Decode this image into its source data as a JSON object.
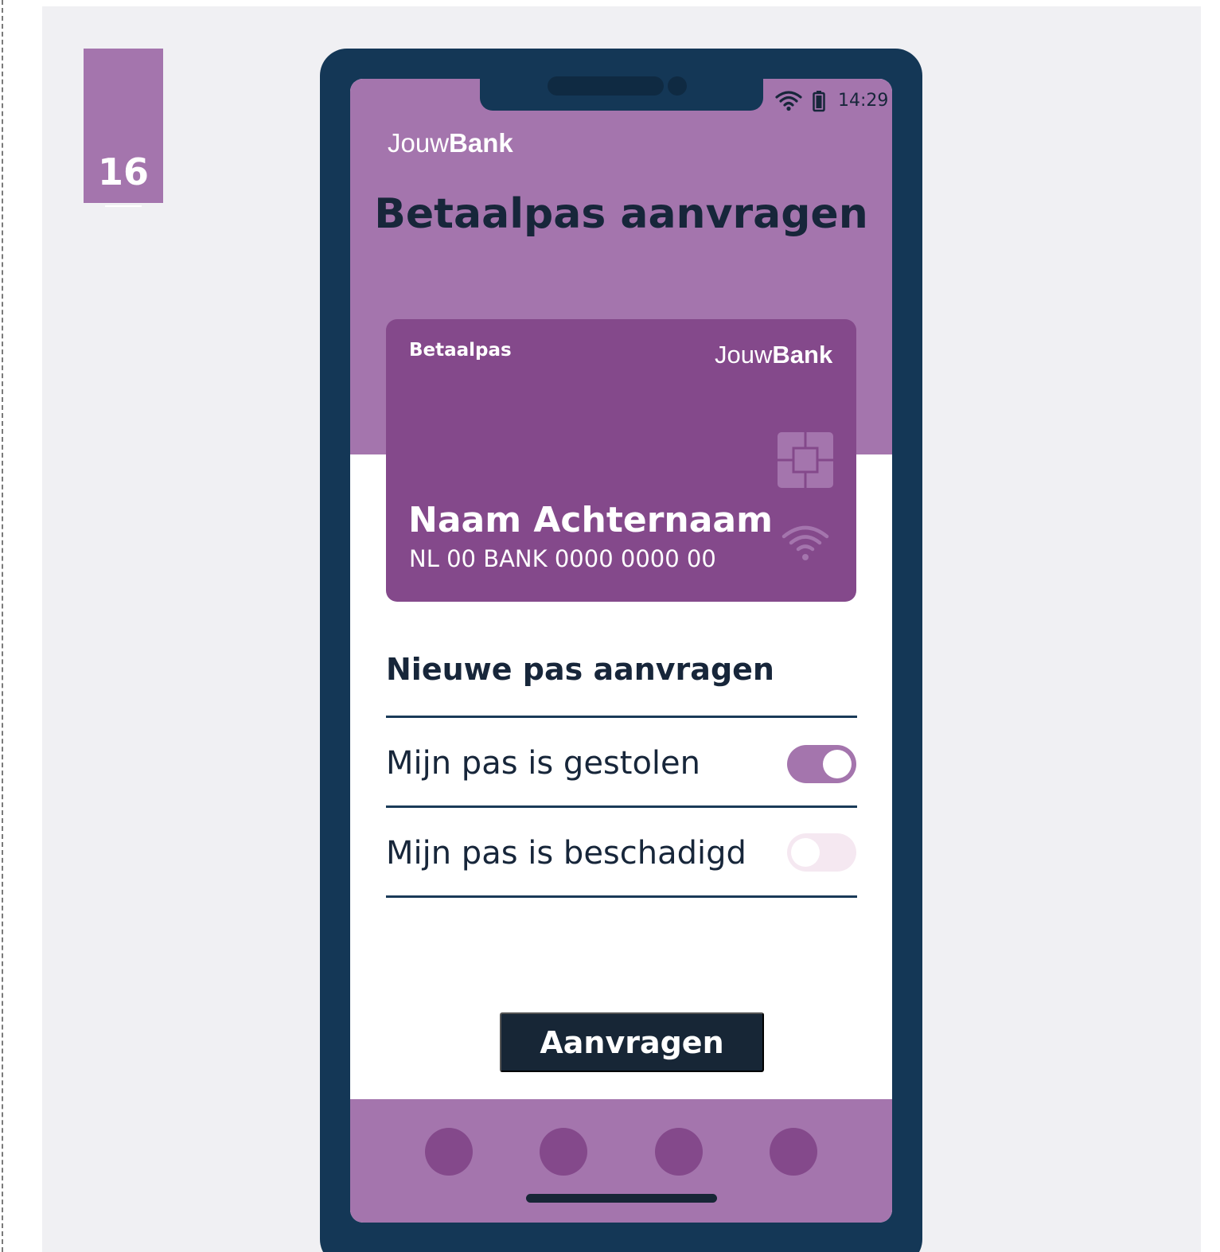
{
  "page_number": "16",
  "status_bar": {
    "time": "14:29",
    "wifi_icon": "wifi-icon",
    "battery_icon": "battery-icon"
  },
  "brand": {
    "name_light": "Jouw",
    "name_bold": "Bank"
  },
  "screen": {
    "title": "Betaalpas aanvragen"
  },
  "card": {
    "label": "Betaalpas",
    "holder_name": "Naam Achternaam",
    "iban": "NL 00 BANK 0000 0000 00",
    "chip_icon": "card-chip-icon",
    "contactless_icon": "contactless-icon"
  },
  "form": {
    "section_title": "Nieuwe pas aanvragen",
    "options": [
      {
        "label": "Mijn pas is gestolen",
        "checked": true
      },
      {
        "label": "Mijn pas is beschadigd",
        "checked": false
      }
    ],
    "submit_label": "Aanvragen"
  },
  "bottom_nav": {
    "item_count": 4
  },
  "colors": {
    "brand_purple": "#a475ad",
    "card_purple": "#84498b",
    "navy": "#143756",
    "text_dark": "#17263a",
    "background": "#f0f0f3"
  }
}
